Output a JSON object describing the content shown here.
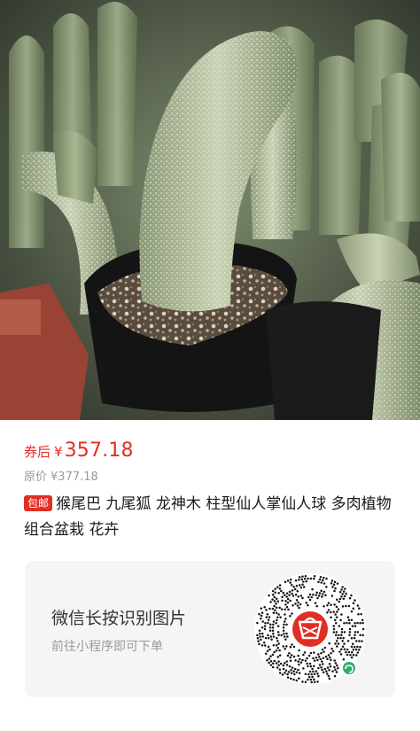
{
  "price": {
    "coupon_label": "券后",
    "currency": "¥",
    "value": "357.18"
  },
  "original": {
    "label": "原价",
    "currency": "¥",
    "value": "377.18"
  },
  "product": {
    "badge": "包邮",
    "title": "猴尾巴 九尾狐 龙神木 柱型仙人掌仙人球 多肉植物组合盆栽 花卉"
  },
  "qr_card": {
    "title": "微信长按识别图片",
    "subtitle": "前往小程序即可下单",
    "center_logo": "pinduoduo-logo",
    "corner_icon": "mini-program-icon"
  },
  "colors": {
    "accent": "#e02e24",
    "muted": "#9a9a9a",
    "card_bg": "#f5f5f5"
  }
}
